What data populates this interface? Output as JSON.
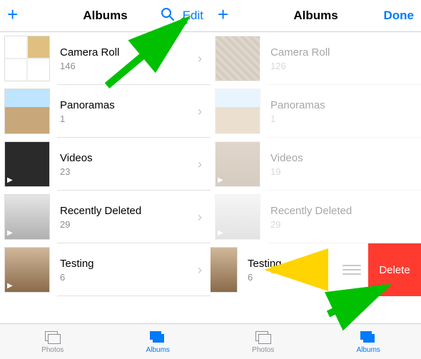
{
  "left": {
    "nav": {
      "add": "+",
      "title": "Albums",
      "edit": "Edit"
    },
    "albums": [
      {
        "name": "Camera Roll",
        "count": "146"
      },
      {
        "name": "Panoramas",
        "count": "1"
      },
      {
        "name": "Videos",
        "count": "23"
      },
      {
        "name": "Recently Deleted",
        "count": "29"
      },
      {
        "name": "Testing",
        "count": "6"
      }
    ]
  },
  "right": {
    "nav": {
      "add": "+",
      "title": "Albums",
      "done": "Done"
    },
    "delete_label": "Delete",
    "albums": [
      {
        "name": "Camera Roll",
        "count": "126"
      },
      {
        "name": "Panoramas",
        "count": "1"
      },
      {
        "name": "Videos",
        "count": "19"
      },
      {
        "name": "Recently Deleted",
        "count": "29"
      },
      {
        "name": "Testing",
        "count": "6"
      }
    ]
  },
  "tabs": {
    "photos": "Photos",
    "albums": "Albums"
  },
  "colors": {
    "accent": "#007aff",
    "destructive": "#ff3b30",
    "annotation_green": "#00c000",
    "annotation_yellow": "#ffd400"
  }
}
